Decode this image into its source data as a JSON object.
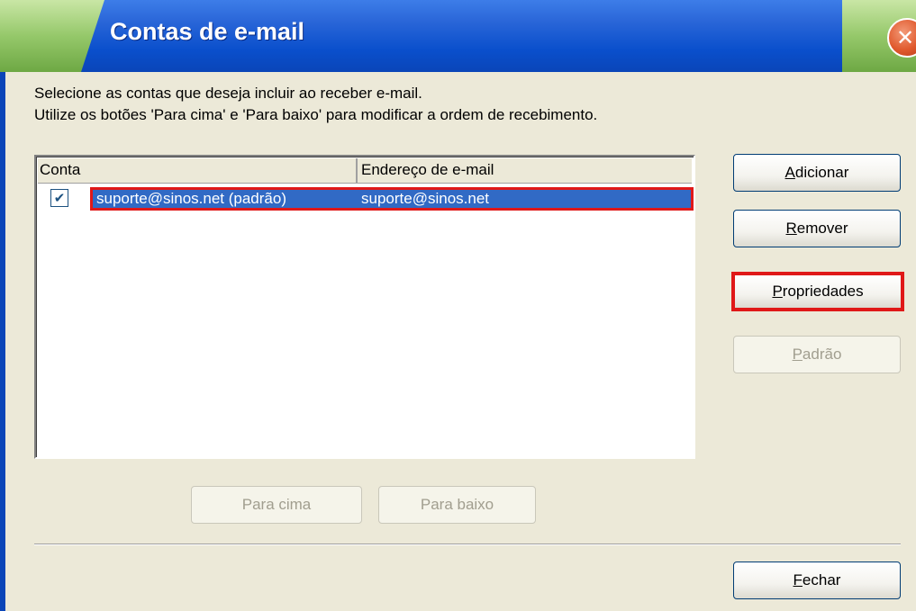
{
  "window": {
    "title": "Contas de e-mail",
    "close_glyph": "✕"
  },
  "description": {
    "line1": "Selecione as contas que deseja incluir ao receber e-mail.",
    "line2": "Utilize os botões 'Para cima' e 'Para baixo' para modificar a ordem de recebimento."
  },
  "list": {
    "columns": [
      "Conta",
      "Endereço de e-mail"
    ],
    "rows": [
      {
        "checked": true,
        "account": "suporte@sinos.net (padrão)",
        "email": "suporte@sinos.net"
      }
    ]
  },
  "buttons": {
    "add": {
      "pre": "",
      "u": "A",
      "post": "dicionar"
    },
    "remove": {
      "pre": "",
      "u": "R",
      "post": "emover"
    },
    "properties": {
      "pre": "",
      "u": "P",
      "post": "ropriedades"
    },
    "default": {
      "pre": "",
      "u": "P",
      "post": "adrão"
    },
    "up": "Para cima",
    "down": "Para baixo",
    "close": {
      "pre": "",
      "u": "F",
      "post": "echar"
    }
  },
  "colors": {
    "title_blue": "#0a4fcc",
    "selection": "#316ac5",
    "highlight_red": "#e01818"
  }
}
